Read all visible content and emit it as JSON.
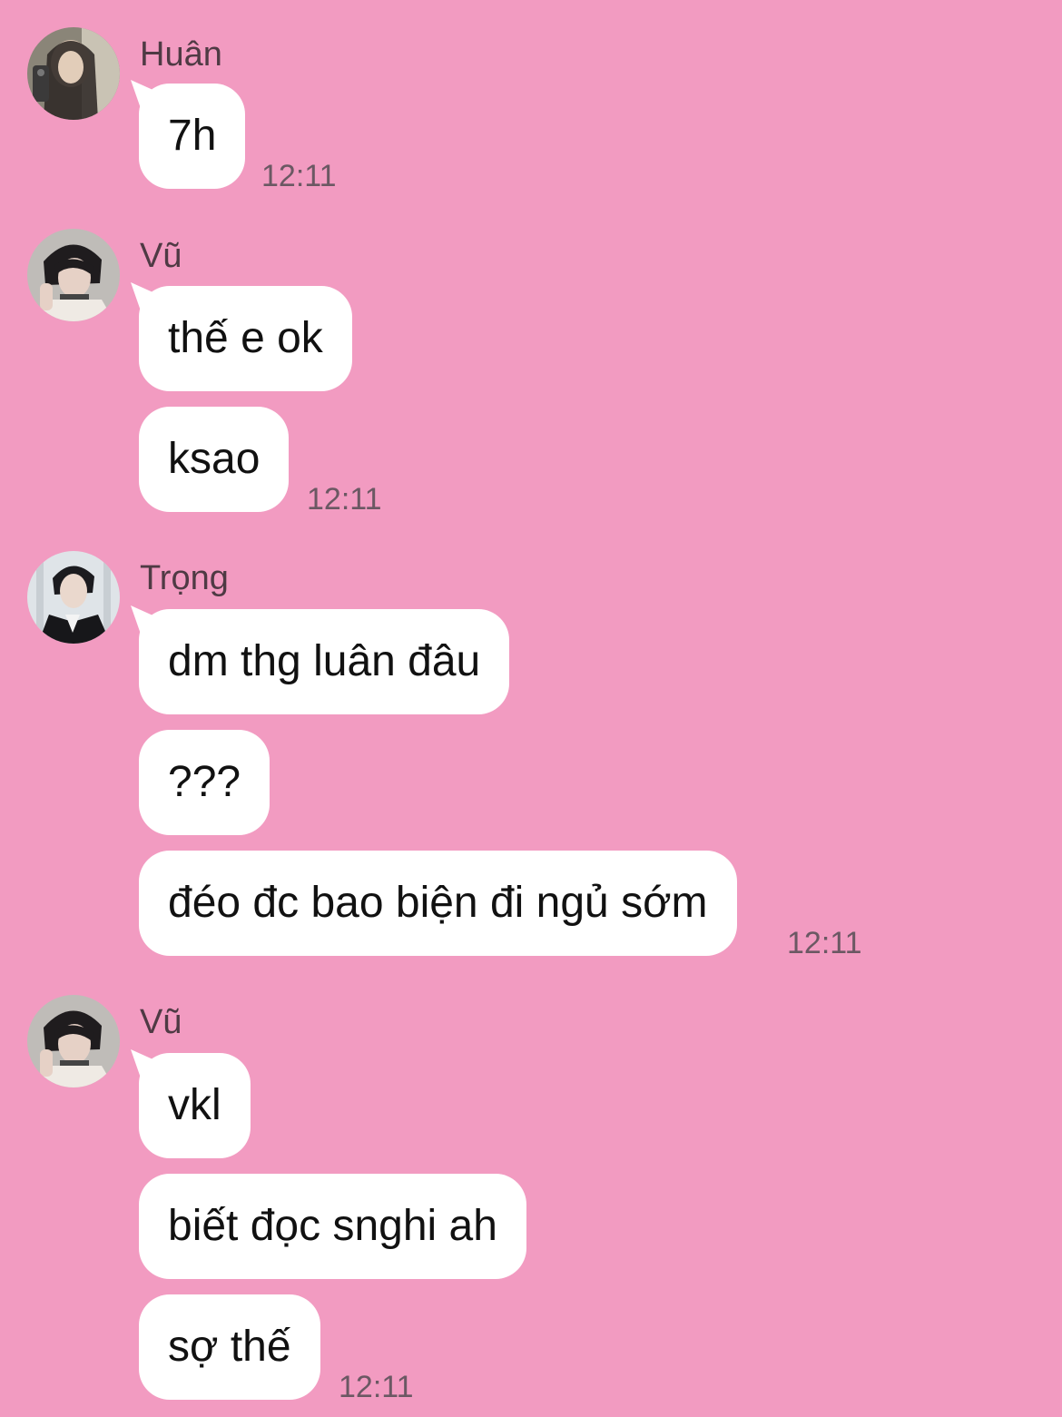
{
  "chat": {
    "groups": [
      {
        "sender": "Huân",
        "avatar_icon": "user-avatar-photo",
        "messages": [
          "7h"
        ],
        "time": "12:11"
      },
      {
        "sender": "Vũ",
        "avatar_icon": "user-avatar-photo",
        "messages": [
          "thế e ok",
          "ksao"
        ],
        "time": "12:11"
      },
      {
        "sender": "Trọng",
        "avatar_icon": "user-avatar-photo",
        "messages": [
          "dm thg luân đâu",
          "???",
          "đéo đc bao biện đi ngủ sớm"
        ],
        "time": "12:11"
      },
      {
        "sender": "Vũ",
        "avatar_icon": "user-avatar-photo",
        "messages": [
          "vkl",
          "biết đọc snghi ah",
          "sợ thế"
        ],
        "time": "12:11"
      }
    ]
  },
  "colors": {
    "background": "#f29bc1",
    "bubble": "#ffffff",
    "sender_text": "#4f3a44",
    "time_text": "#6b5863"
  }
}
